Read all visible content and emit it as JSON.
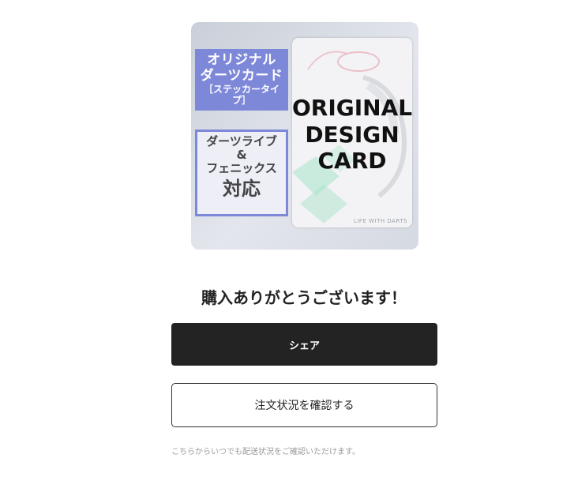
{
  "product_image": {
    "title_lines": [
      "オリジナル",
      "ダーツカード"
    ],
    "title_sub": "［ステッカータイプ］",
    "compat_lines": [
      "ダーツライブ",
      "&",
      "フェニックス"
    ],
    "compat_big": "対応",
    "card_lines": [
      "ORIGINAL",
      "DESIGN",
      "CARD"
    ],
    "card_footer": "LIFE WITH DARTS"
  },
  "thanks_message": "購入ありがとうございます！",
  "buttons": {
    "share": "シェア",
    "check_order": "注文状況を確認する"
  },
  "note": "こちらからいつでも配送状況をご確認いただけます。",
  "colors": {
    "accent_blue": "#7e88d8",
    "dark_button": "#232323"
  }
}
